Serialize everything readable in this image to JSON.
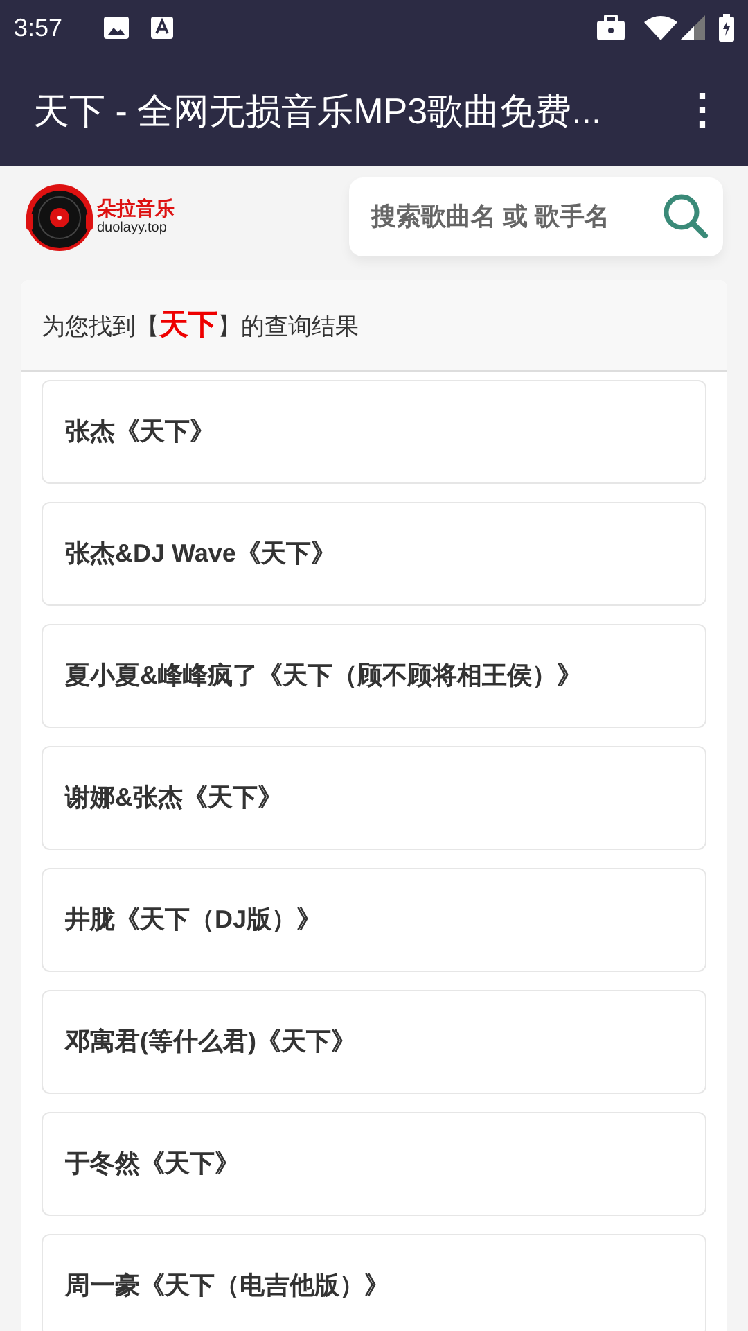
{
  "status_bar": {
    "time": "3:57"
  },
  "app_bar": {
    "title": "天下 - 全网无损音乐MP3歌曲免费...",
    "menu_icon": "⋮"
  },
  "logo": {
    "name": "朵拉音乐",
    "domain": "duolayy.top"
  },
  "search": {
    "placeholder": "搜索歌曲名 或 歌手名"
  },
  "results": {
    "heading": "为您找到【**天下**】的查询结果",
    "items": [
      {
        "title": "张杰《天下》"
      },
      {
        "title": "张杰&DJ Wave《天下》"
      },
      {
        "title": "夏小夏&峰峰疯了《天下（顾不顾将相王侯）》"
      },
      {
        "title": "谢娜&张杰《天下》"
      },
      {
        "title": "井胧《天下（DJ版）》"
      },
      {
        "title": "邓寓君(等什么君)《天下》"
      },
      {
        "title": "于冬然《天下》"
      },
      {
        "title": "周一豪《天下（电吉他版）》"
      }
    ]
  }
}
